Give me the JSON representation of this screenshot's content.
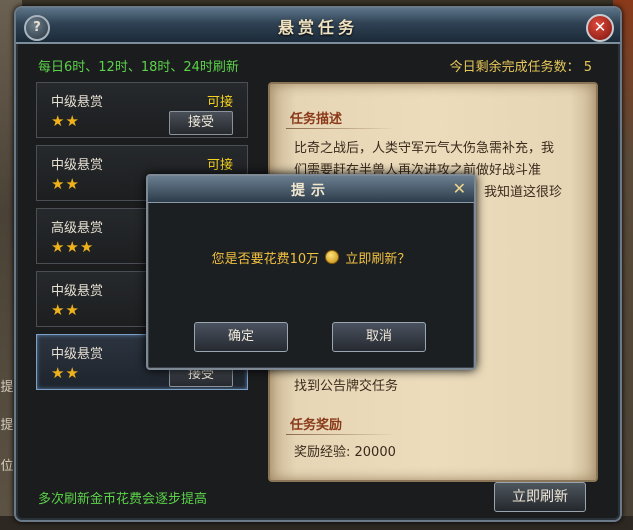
{
  "window": {
    "title": "悬赏任务",
    "help_label": "?",
    "close_label": "✕"
  },
  "header": {
    "refresh_info": "每日6时、12时、18时、24时刷新",
    "remaining": "今日剩余完成任务数： 5"
  },
  "tasks": [
    {
      "name": "中级悬赏",
      "stars": "★★",
      "status": "可接",
      "accept": "接受"
    },
    {
      "name": "中级悬赏",
      "stars": "★★",
      "status": "可接",
      "accept": ""
    },
    {
      "name": "高级悬赏",
      "stars": "★★★",
      "status": "",
      "accept": ""
    },
    {
      "name": "中级悬赏",
      "stars": "★★",
      "status": "",
      "accept": ""
    },
    {
      "name": "中级悬赏",
      "stars": "★★",
      "status": "",
      "accept": "接受"
    }
  ],
  "detail": {
    "desc_heading": "任务描述",
    "desc_lines": [
      "比奇之战后，人类守军元气大伤急需补充，我",
      "们需要赶在半兽人再次进攻之前做好战斗准",
      "我知道这很珍"
    ],
    "desc_tail": "找到公告牌交任务",
    "reward_heading": "任务奖励",
    "reward_exp": "奖励经验: 20000"
  },
  "footer": {
    "note": "多次刷新金币花费会逐步提高",
    "refresh_button": "立即刷新"
  },
  "dialog": {
    "title": "提示",
    "close": "✕",
    "message_before": "您是否要花费10万",
    "message_after": "立即刷新？",
    "confirm": "确定",
    "cancel": "取消"
  },
  "side_letters": [
    "提",
    "提",
    "位"
  ],
  "colors": {
    "green_text": "#5cd24a",
    "gold_text": "#f0c040",
    "star": "#f0b21a"
  }
}
